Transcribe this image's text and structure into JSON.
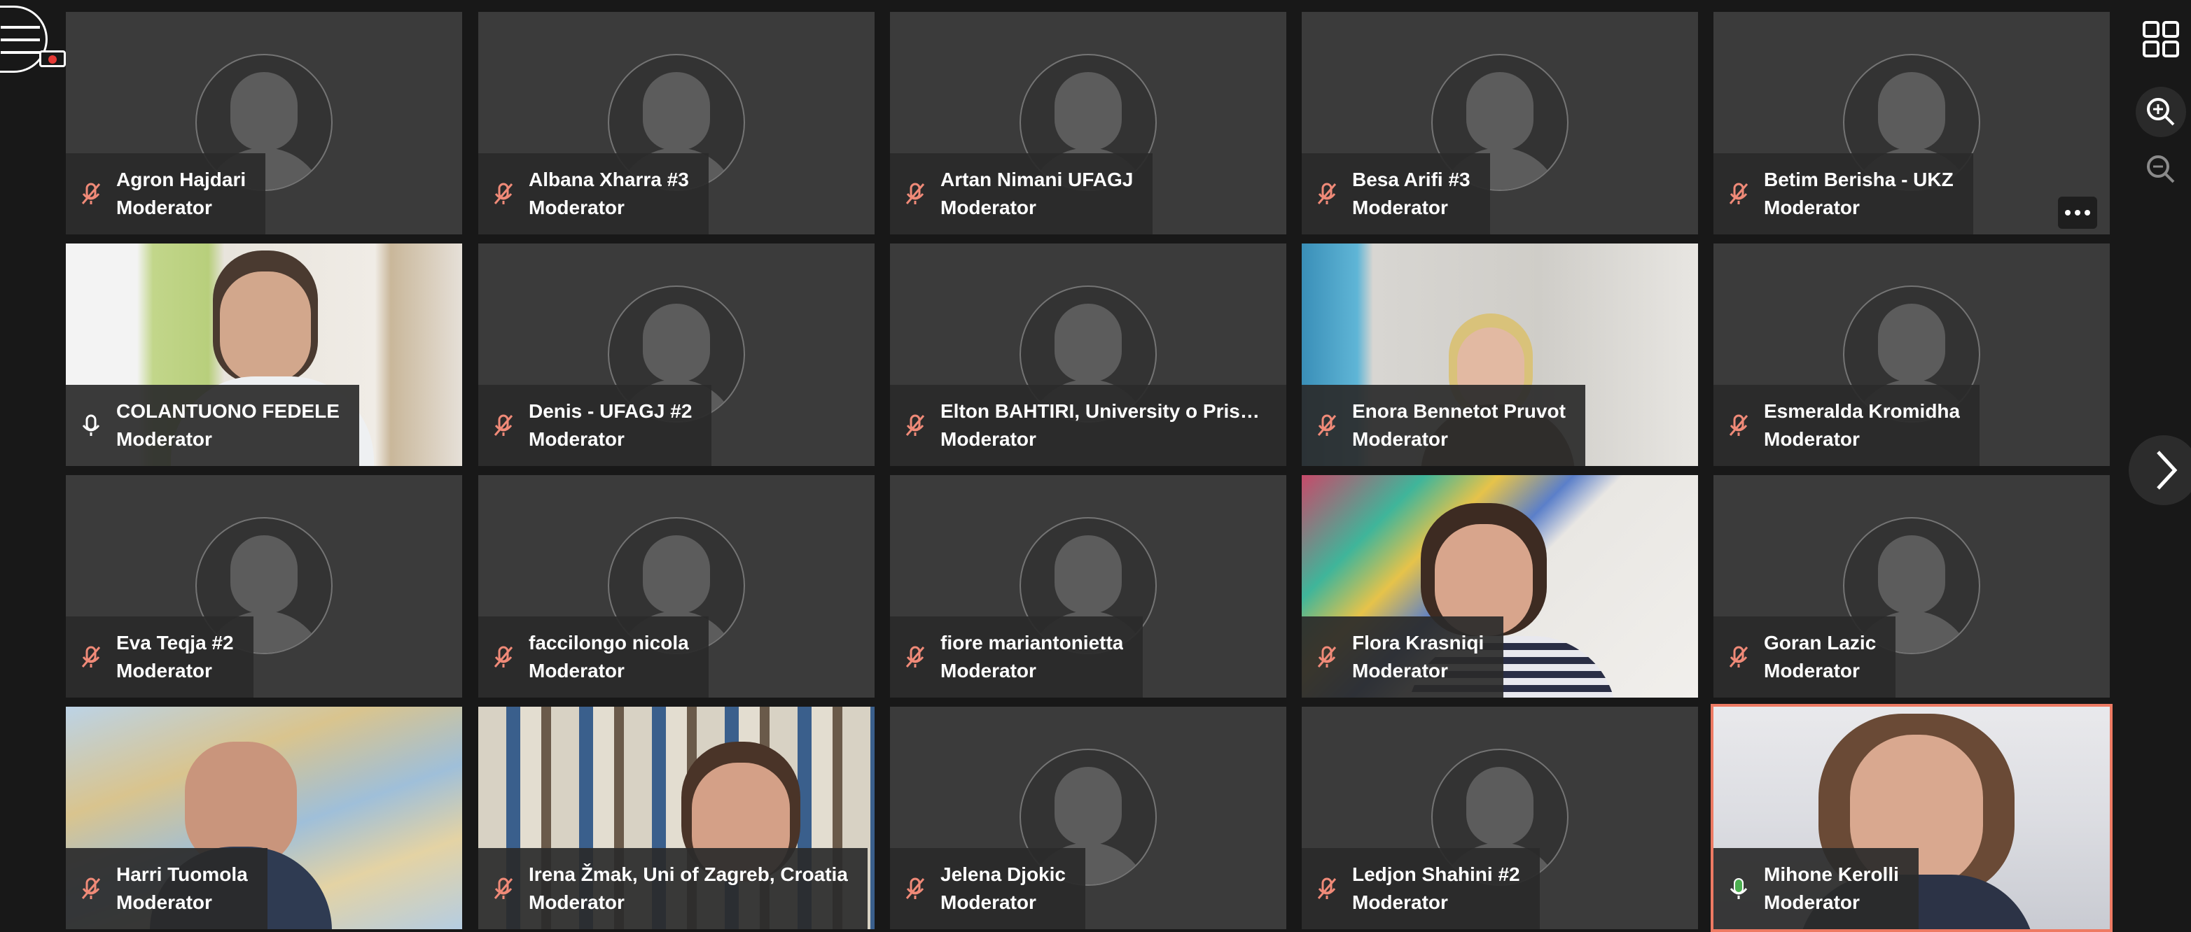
{
  "toolbar": {
    "menu_icon": "hamburger-menu-icon",
    "recording_icon": "recording-camera-icon",
    "layout_icon": "grid-layout-icon",
    "zoom_in_icon": "zoom-in-icon",
    "zoom_out_icon": "zoom-out-icon",
    "next_page_icon": "chevron-right-icon"
  },
  "colors": {
    "background": "#181818",
    "tile": "#3b3b3b",
    "muted_mic": "#f08a78",
    "active_mic": "#4caf50",
    "speaker_border": "#ee7a63"
  },
  "participants": [
    {
      "name": "Agron Hajdari",
      "role": "Moderator",
      "mic": "muted",
      "video": false
    },
    {
      "name": "Albana Xharra #3",
      "role": "Moderator",
      "mic": "muted",
      "video": false
    },
    {
      "name": "Artan Nimani UFAGJ",
      "role": "Moderator",
      "mic": "muted",
      "video": false
    },
    {
      "name": "Besa Arifi #3",
      "role": "Moderator",
      "mic": "muted",
      "video": false
    },
    {
      "name": "Betim Berisha - UKZ",
      "role": "Moderator",
      "mic": "muted",
      "video": false
    },
    {
      "name": "COLANTUONO FEDELE",
      "role": "Moderator",
      "mic": "on",
      "video": true
    },
    {
      "name": "Denis - UFAGJ #2",
      "role": "Moderator",
      "mic": "muted",
      "video": false
    },
    {
      "name": "Elton BAHTIRI, University o Prisht...",
      "role": "Moderator",
      "mic": "muted",
      "video": false
    },
    {
      "name": "Enora Bennetot Pruvot",
      "role": "Moderator",
      "mic": "muted",
      "video": true
    },
    {
      "name": "Esmeralda Kromidha",
      "role": "Moderator",
      "mic": "muted",
      "video": false
    },
    {
      "name": "Eva Teqja #2",
      "role": "Moderator",
      "mic": "muted",
      "video": false
    },
    {
      "name": "faccilongo nicola",
      "role": "Moderator",
      "mic": "muted",
      "video": false
    },
    {
      "name": "fiore mariantonietta",
      "role": "Moderator",
      "mic": "muted",
      "video": false
    },
    {
      "name": "Flora Krasniqi",
      "role": "Moderator",
      "mic": "muted",
      "video": true
    },
    {
      "name": "Goran Lazic",
      "role": "Moderator",
      "mic": "muted",
      "video": false
    },
    {
      "name": "Harri Tuomola",
      "role": "Moderator",
      "mic": "muted",
      "video": true
    },
    {
      "name": "Irena Žmak, Uni of Zagreb, Croatia",
      "role": "Moderator",
      "mic": "muted",
      "video": true
    },
    {
      "name": "Jelena Djokic",
      "role": "Moderator",
      "mic": "muted",
      "video": false
    },
    {
      "name": "Ledjon Shahini #2",
      "role": "Moderator",
      "mic": "muted",
      "video": false
    },
    {
      "name": "Mihone Kerolli",
      "role": "Moderator",
      "mic": "speaking",
      "video": true
    }
  ]
}
